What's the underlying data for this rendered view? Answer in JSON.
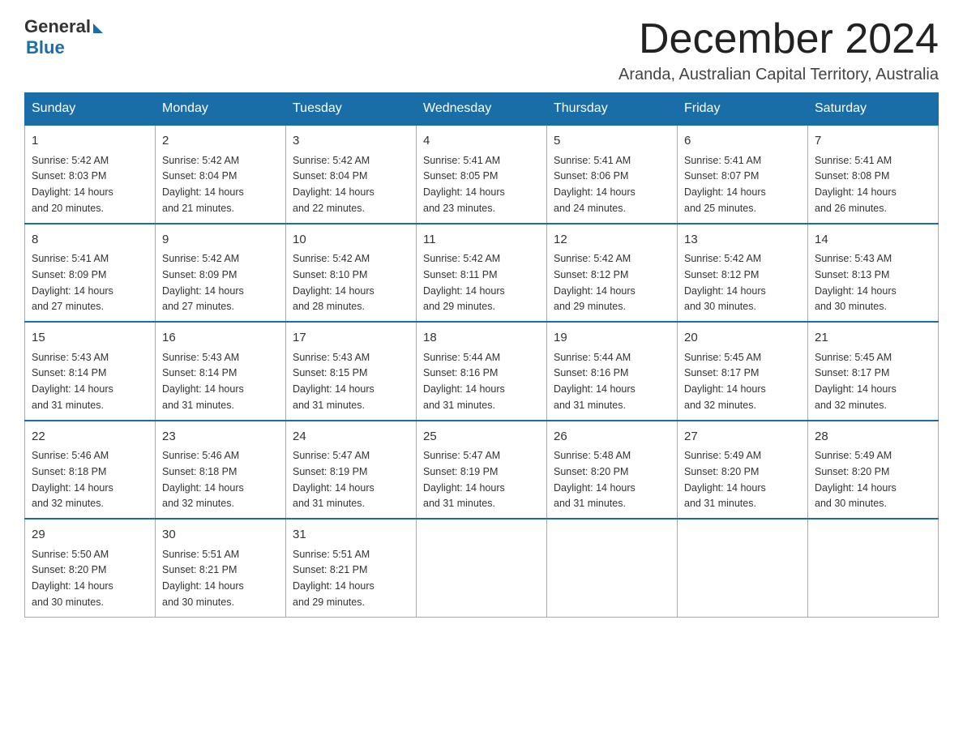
{
  "header": {
    "logo_general": "General",
    "logo_blue": "Blue",
    "month_title": "December 2024",
    "location": "Aranda, Australian Capital Territory, Australia"
  },
  "days_of_week": [
    "Sunday",
    "Monday",
    "Tuesday",
    "Wednesday",
    "Thursday",
    "Friday",
    "Saturday"
  ],
  "weeks": [
    [
      {
        "day": "1",
        "sunrise": "5:42 AM",
        "sunset": "8:03 PM",
        "daylight": "14 hours and 20 minutes."
      },
      {
        "day": "2",
        "sunrise": "5:42 AM",
        "sunset": "8:04 PM",
        "daylight": "14 hours and 21 minutes."
      },
      {
        "day": "3",
        "sunrise": "5:42 AM",
        "sunset": "8:04 PM",
        "daylight": "14 hours and 22 minutes."
      },
      {
        "day": "4",
        "sunrise": "5:41 AM",
        "sunset": "8:05 PM",
        "daylight": "14 hours and 23 minutes."
      },
      {
        "day": "5",
        "sunrise": "5:41 AM",
        "sunset": "8:06 PM",
        "daylight": "14 hours and 24 minutes."
      },
      {
        "day": "6",
        "sunrise": "5:41 AM",
        "sunset": "8:07 PM",
        "daylight": "14 hours and 25 minutes."
      },
      {
        "day": "7",
        "sunrise": "5:41 AM",
        "sunset": "8:08 PM",
        "daylight": "14 hours and 26 minutes."
      }
    ],
    [
      {
        "day": "8",
        "sunrise": "5:41 AM",
        "sunset": "8:09 PM",
        "daylight": "14 hours and 27 minutes."
      },
      {
        "day": "9",
        "sunrise": "5:42 AM",
        "sunset": "8:09 PM",
        "daylight": "14 hours and 27 minutes."
      },
      {
        "day": "10",
        "sunrise": "5:42 AM",
        "sunset": "8:10 PM",
        "daylight": "14 hours and 28 minutes."
      },
      {
        "day": "11",
        "sunrise": "5:42 AM",
        "sunset": "8:11 PM",
        "daylight": "14 hours and 29 minutes."
      },
      {
        "day": "12",
        "sunrise": "5:42 AM",
        "sunset": "8:12 PM",
        "daylight": "14 hours and 29 minutes."
      },
      {
        "day": "13",
        "sunrise": "5:42 AM",
        "sunset": "8:12 PM",
        "daylight": "14 hours and 30 minutes."
      },
      {
        "day": "14",
        "sunrise": "5:43 AM",
        "sunset": "8:13 PM",
        "daylight": "14 hours and 30 minutes."
      }
    ],
    [
      {
        "day": "15",
        "sunrise": "5:43 AM",
        "sunset": "8:14 PM",
        "daylight": "14 hours and 31 minutes."
      },
      {
        "day": "16",
        "sunrise": "5:43 AM",
        "sunset": "8:14 PM",
        "daylight": "14 hours and 31 minutes."
      },
      {
        "day": "17",
        "sunrise": "5:43 AM",
        "sunset": "8:15 PM",
        "daylight": "14 hours and 31 minutes."
      },
      {
        "day": "18",
        "sunrise": "5:44 AM",
        "sunset": "8:16 PM",
        "daylight": "14 hours and 31 minutes."
      },
      {
        "day": "19",
        "sunrise": "5:44 AM",
        "sunset": "8:16 PM",
        "daylight": "14 hours and 31 minutes."
      },
      {
        "day": "20",
        "sunrise": "5:45 AM",
        "sunset": "8:17 PM",
        "daylight": "14 hours and 32 minutes."
      },
      {
        "day": "21",
        "sunrise": "5:45 AM",
        "sunset": "8:17 PM",
        "daylight": "14 hours and 32 minutes."
      }
    ],
    [
      {
        "day": "22",
        "sunrise": "5:46 AM",
        "sunset": "8:18 PM",
        "daylight": "14 hours and 32 minutes."
      },
      {
        "day": "23",
        "sunrise": "5:46 AM",
        "sunset": "8:18 PM",
        "daylight": "14 hours and 32 minutes."
      },
      {
        "day": "24",
        "sunrise": "5:47 AM",
        "sunset": "8:19 PM",
        "daylight": "14 hours and 31 minutes."
      },
      {
        "day": "25",
        "sunrise": "5:47 AM",
        "sunset": "8:19 PM",
        "daylight": "14 hours and 31 minutes."
      },
      {
        "day": "26",
        "sunrise": "5:48 AM",
        "sunset": "8:20 PM",
        "daylight": "14 hours and 31 minutes."
      },
      {
        "day": "27",
        "sunrise": "5:49 AM",
        "sunset": "8:20 PM",
        "daylight": "14 hours and 31 minutes."
      },
      {
        "day": "28",
        "sunrise": "5:49 AM",
        "sunset": "8:20 PM",
        "daylight": "14 hours and 30 minutes."
      }
    ],
    [
      {
        "day": "29",
        "sunrise": "5:50 AM",
        "sunset": "8:20 PM",
        "daylight": "14 hours and 30 minutes."
      },
      {
        "day": "30",
        "sunrise": "5:51 AM",
        "sunset": "8:21 PM",
        "daylight": "14 hours and 30 minutes."
      },
      {
        "day": "31",
        "sunrise": "5:51 AM",
        "sunset": "8:21 PM",
        "daylight": "14 hours and 29 minutes."
      },
      null,
      null,
      null,
      null
    ]
  ],
  "labels": {
    "sunrise": "Sunrise:",
    "sunset": "Sunset:",
    "daylight": "Daylight:"
  }
}
